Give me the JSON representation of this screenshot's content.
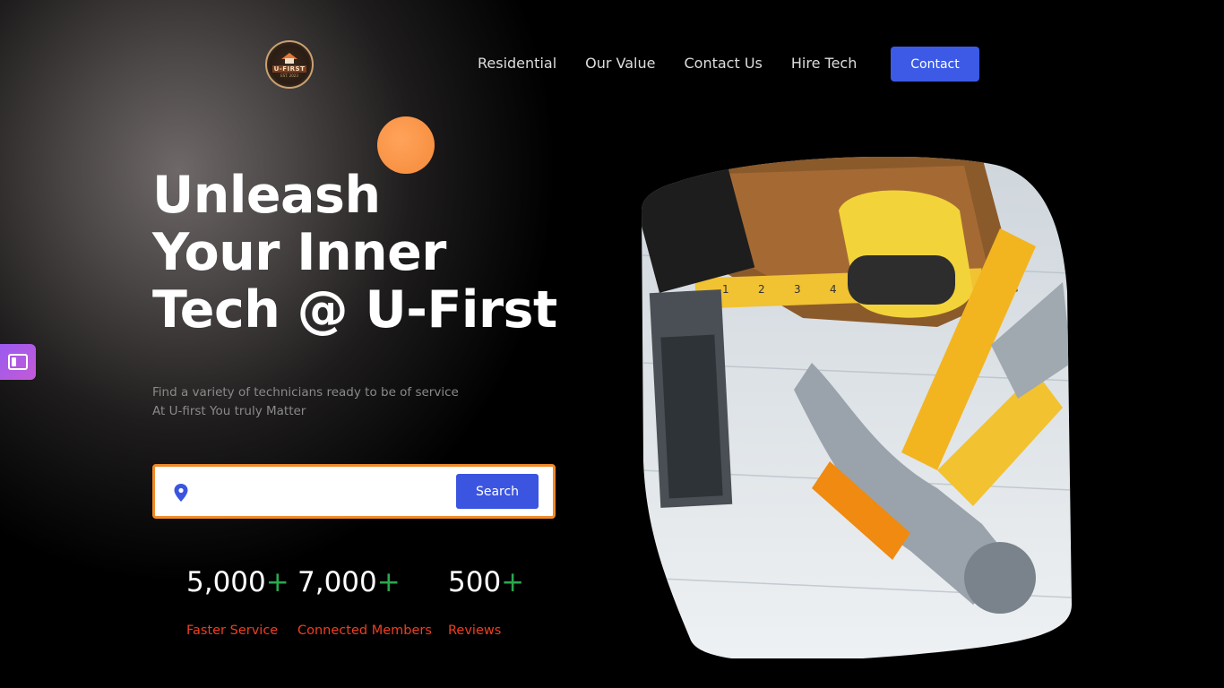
{
  "brand": {
    "logo_text": "U-FIRST",
    "logo_est": "EST. 2023"
  },
  "nav": {
    "items": [
      {
        "label": "Residential"
      },
      {
        "label": "Our Value"
      },
      {
        "label": "Contact Us"
      },
      {
        "label": "Hire Tech"
      }
    ],
    "contact_label": "Contact"
  },
  "hero": {
    "title_lines": [
      "Unleash",
      "Your Inner",
      "Tech @ U-First"
    ],
    "subtitle_lines": [
      "Find a variety of technicians ready to be of service",
      "At U-first You truly Matter"
    ]
  },
  "search": {
    "placeholder": "",
    "button_label": "Search",
    "icon": "location-pin-icon"
  },
  "stats": [
    {
      "value": "5,000",
      "plus": "+",
      "label": "Faster Service"
    },
    {
      "value": "7,000",
      "plus": "+",
      "label": "Connected Members"
    },
    {
      "value": "500",
      "plus": "+",
      "label": "Reviews"
    }
  ],
  "side_tab": {
    "icon": "sidebar-panel-icon"
  },
  "colors": {
    "accent": "#3c5ae6",
    "orange": "#f08a2a",
    "stat_plus": "#2aa84a",
    "stat_label": "#ee3f22"
  }
}
